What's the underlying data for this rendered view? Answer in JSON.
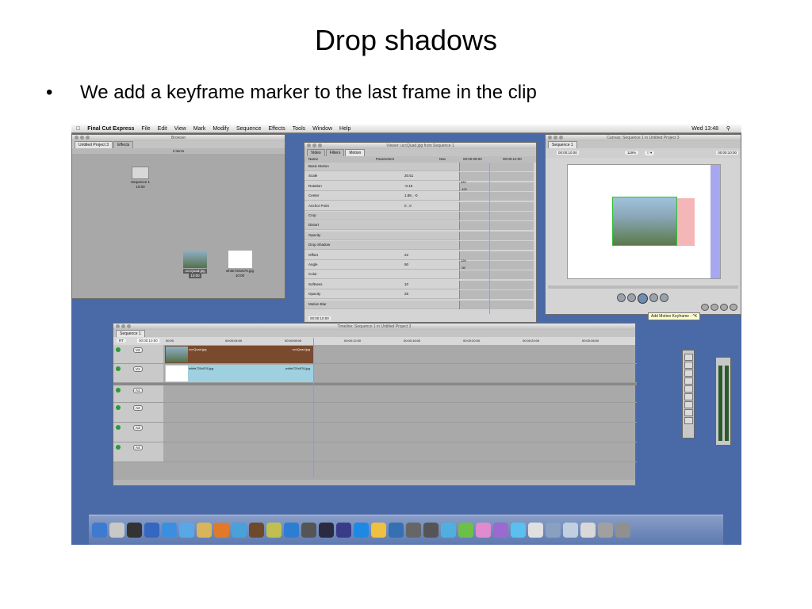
{
  "slide": {
    "title": "Drop shadows",
    "bullet_marker": "•",
    "bullet": "We add a keyframe marker to the last frame in the clip"
  },
  "menubar": {
    "app": "Final Cut Express",
    "items": [
      "File",
      "Edit",
      "View",
      "Mark",
      "Modify",
      "Sequence",
      "Effects",
      "Tools",
      "Window",
      "Help"
    ],
    "clock": "Wed 13:48"
  },
  "browser": {
    "title": "Browser",
    "tabs": [
      "Untitled Project 3",
      "Effects"
    ],
    "count": "3 items",
    "clips": [
      {
        "name": "Sequence 1",
        "dur": "10:00"
      },
      {
        "name": "uccQuad.jpg",
        "dur": "10:00"
      },
      {
        "name": "white720x576.jpg",
        "dur": "10:00"
      }
    ]
  },
  "viewer": {
    "title": "Viewer: uccQuad.jpg from Sequence 1",
    "tabs": [
      "Video",
      "Filters",
      "Motion"
    ],
    "headers": {
      "name": "Name",
      "params": "Parameters",
      "nav": "Nav",
      "t1": "00:00:08:00",
      "t2": "00:00:12:00"
    },
    "rows": [
      {
        "name": "Basic Motion",
        "val": "",
        "section": true
      },
      {
        "name": "Scale",
        "val": "20.51",
        "section": false
      },
      {
        "name": "Rotation",
        "val": "-0.15",
        "section": false
      },
      {
        "name": "Center",
        "val": "1.88 ,       -0",
        "section": false
      },
      {
        "name": "Anchor Point",
        "val": "0 ,       0",
        "section": false
      },
      {
        "name": "Crop",
        "val": "",
        "section": true
      },
      {
        "name": "Distort",
        "val": "",
        "section": true
      },
      {
        "name": "Opacity",
        "val": "",
        "section": true
      },
      {
        "name": "Drop Shadow",
        "val": "",
        "section": true
      },
      {
        "name": "Offset",
        "val": "22",
        "section": false
      },
      {
        "name": "Angle",
        "val": "90",
        "section": false
      },
      {
        "name": "Color",
        "val": "",
        "section": false
      },
      {
        "name": "Softness",
        "val": "10",
        "section": false
      },
      {
        "name": "Opacity",
        "val": "25",
        "section": false
      },
      {
        "name": "Motion Blur",
        "val": "",
        "section": true
      }
    ],
    "range_top": "432",
    "range_bottom": "-432",
    "range_top2": "126",
    "range_bottom2": "-36",
    "timecode": "00:00:10:00"
  },
  "canvas": {
    "title": "Canvas: Sequence 1 in Untitled Project 3",
    "tab": "Sequence 1",
    "timecode_left": "00:00:10:00",
    "zoom": "119%",
    "timecode_right": "00:00:10:00",
    "tooltip": "Add Motion Keyframe - ^K"
  },
  "timeline": {
    "title": "Timeline: Sequence 1 in Untitled Project 3",
    "tab": "Sequence 1",
    "rt": "RT",
    "timecode": "00:00:10:00",
    "ruler": [
      "00:00",
      "00:00:04:00",
      "00:00:08:00",
      "00:00:12:00",
      "00:00:16:00",
      "00:00:20:00",
      "00:00:24:00",
      "00:00:28:00"
    ],
    "tracks": [
      {
        "label": "V2",
        "clip_left": "uccQuad.jpg",
        "clip_right": "uccQuad.jpg"
      },
      {
        "label": "V1",
        "clip_left": "white720x576.jpg",
        "clip_right": "white720x576.jpg"
      },
      {
        "label": "A1"
      },
      {
        "label": "A2"
      },
      {
        "label": "A3"
      },
      {
        "label": "A4"
      }
    ],
    "v1_source": "v1"
  },
  "colors": {
    "desktop": "#4a6aa7",
    "v2_clip": "#7a4a2e",
    "v1_clip": "#9fd0e0",
    "shadow": "#f4b6b6"
  }
}
